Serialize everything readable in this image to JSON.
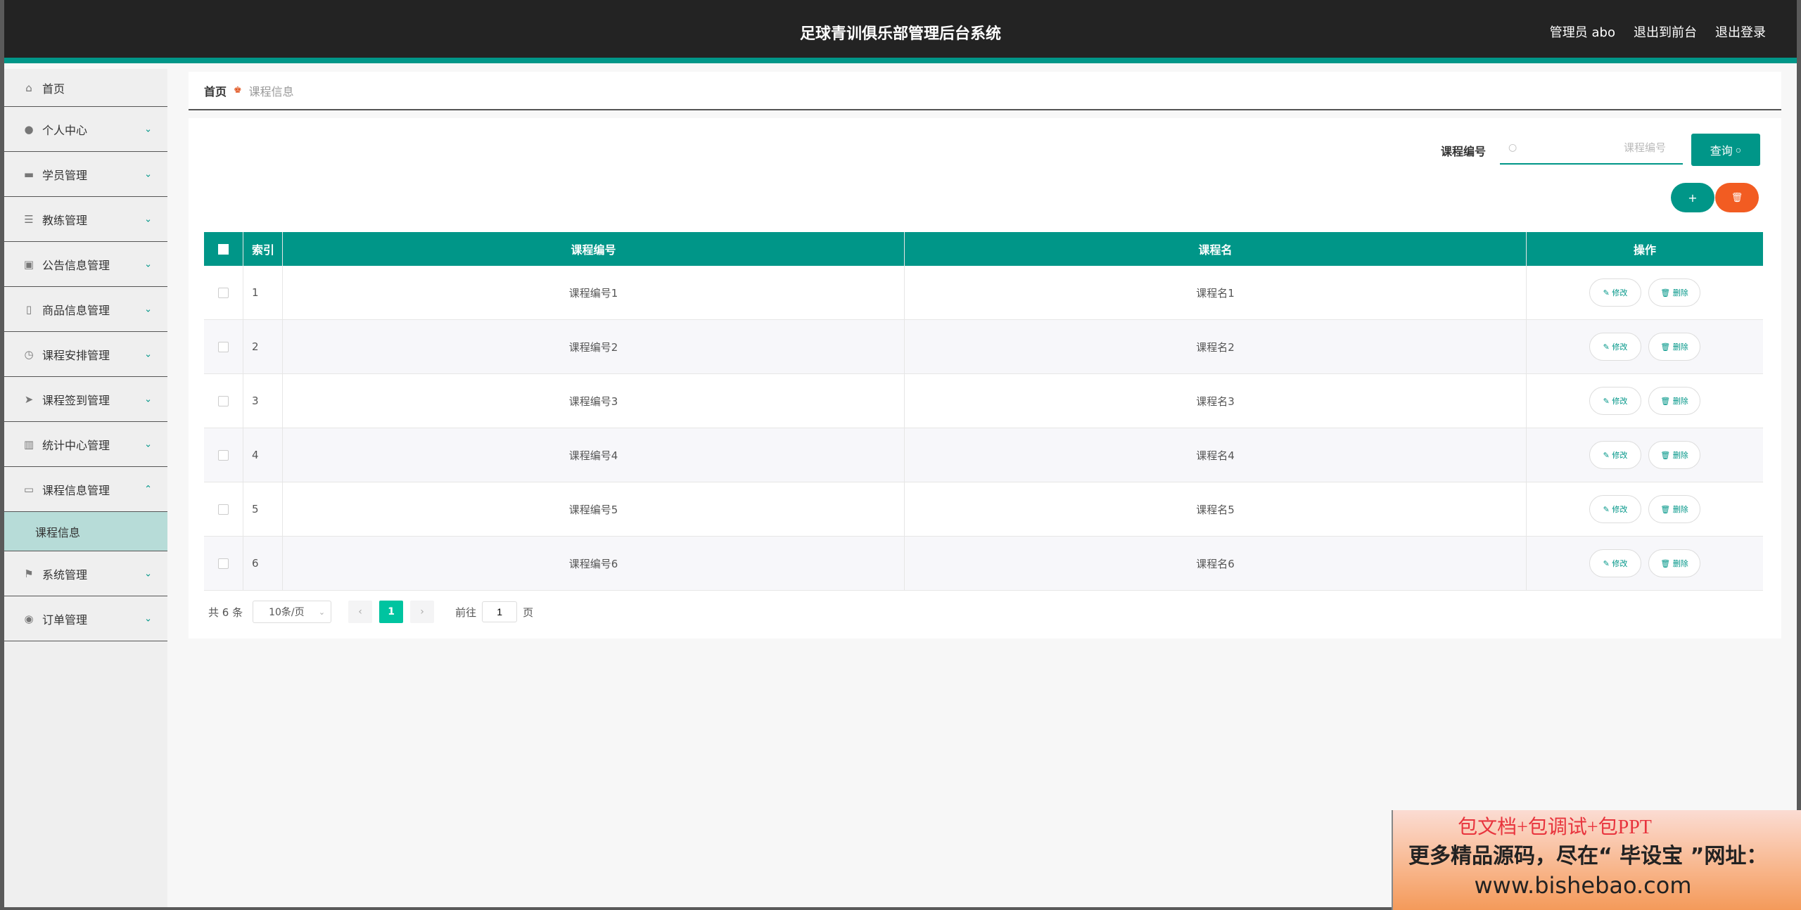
{
  "header": {
    "title": "足球青训俱乐部管理后台系统",
    "admin": "管理员 abo",
    "to_front": "退出到前台",
    "logout": "退出登录"
  },
  "sidebar": {
    "items": [
      {
        "label": "首页",
        "icon": "home-icon"
      },
      {
        "label": "个人中心",
        "icon": "user-icon"
      },
      {
        "label": "学员管理",
        "icon": "ticket-icon"
      },
      {
        "label": "教练管理",
        "icon": "list-icon"
      },
      {
        "label": "公告信息管理",
        "icon": "clipboard-icon"
      },
      {
        "label": "商品信息管理",
        "icon": "phone-icon"
      },
      {
        "label": "课程安排管理",
        "icon": "clock-icon"
      },
      {
        "label": "课程签到管理",
        "icon": "send-icon"
      },
      {
        "label": "统计中心管理",
        "icon": "chart-icon"
      },
      {
        "label": "课程信息管理",
        "icon": "monitor-icon"
      },
      {
        "label": "系统管理",
        "icon": "flag-icon"
      },
      {
        "label": "订单管理",
        "icon": "location-icon"
      }
    ],
    "sub_item": "课程信息"
  },
  "breadcrumb": {
    "home": "首页",
    "current": "课程信息"
  },
  "search": {
    "label": "课程编号",
    "placeholder": "课程编号",
    "button": "查询"
  },
  "actions": {
    "add": "+",
    "delete_icon": "trash-icon"
  },
  "table": {
    "headers": [
      "索引",
      "课程编号",
      "课程名",
      "操作"
    ],
    "rows": [
      {
        "index": "1",
        "code": "课程编号1",
        "name": "课程名1"
      },
      {
        "index": "2",
        "code": "课程编号2",
        "name": "课程名2"
      },
      {
        "index": "3",
        "code": "课程编号3",
        "name": "课程名3"
      },
      {
        "index": "4",
        "code": "课程编号4",
        "name": "课程名4"
      },
      {
        "index": "5",
        "code": "课程编号5",
        "name": "课程名5"
      },
      {
        "index": "6",
        "code": "课程编号6",
        "name": "课程名6"
      }
    ],
    "edit_label": "修改",
    "delete_label": "删除"
  },
  "pagination": {
    "total": "共 6 条",
    "page_size": "10条/页",
    "current_page": "1",
    "goto_prefix": "前往",
    "goto_value": "1",
    "goto_suffix": "页"
  },
  "promo": {
    "line1": "包文档+包调试+包PPT",
    "line2": "更多精品源码，尽在“ 毕设宝 ”网址：",
    "line3": "www.bishebao.com"
  },
  "colors": {
    "accent": "#009688",
    "danger": "#f25c22",
    "header_bg": "#232323"
  }
}
